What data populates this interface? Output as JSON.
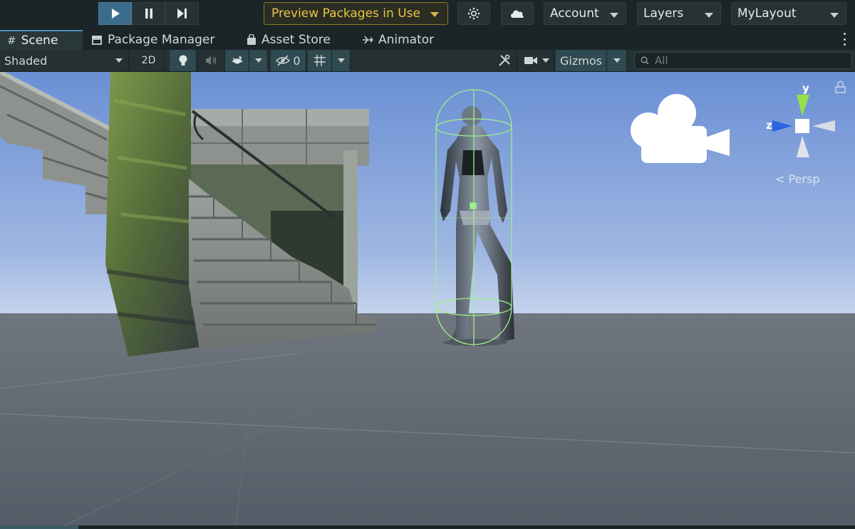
{
  "toolbar": {
    "preview_label": "Preview Packages in Use",
    "account_label": "Account",
    "layers_label": "Layers",
    "layout_label": "MyLayout",
    "play_icon": "play-icon",
    "pause_icon": "pause-icon",
    "step_icon": "step-icon",
    "settings_icon": "settings-icon",
    "cloud_icon": "cloud-icon"
  },
  "tabs": [
    {
      "label": "Scene",
      "icon": "grid-icon",
      "active": true
    },
    {
      "label": "Package Manager",
      "icon": "package-icon",
      "active": false
    },
    {
      "label": "Asset Store",
      "icon": "store-icon",
      "active": false
    },
    {
      "label": "Animator",
      "icon": "animator-icon",
      "active": false
    }
  ],
  "scene_toolbar": {
    "shading_mode": "Shaded",
    "mode_2d": "2D",
    "hidden_count": "0",
    "gizmos_label": "Gizmos",
    "search_placeholder": "All"
  },
  "scene": {
    "projection_label": "Persp",
    "axis_y": "y",
    "axis_z": "z"
  },
  "colors": {
    "sky_top": "#6a8fd4",
    "sky_horizon": "#c5d4ec",
    "ground": "#5f6773",
    "collider": "#9df08a",
    "preview_accent": "#e9c54a"
  }
}
